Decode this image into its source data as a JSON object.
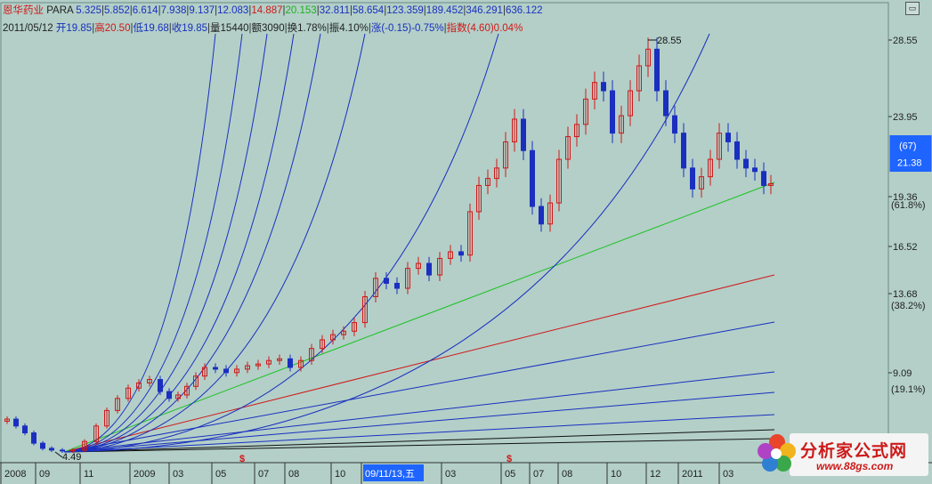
{
  "header": {
    "stock_name": "恩华药业",
    "indicator": "PARA",
    "indicator_values": [
      "5.325",
      "5.852",
      "6.614",
      "7.938",
      "9.137",
      "12.083",
      "14.887",
      "20.153",
      "32.811",
      "58.654",
      "123.359",
      "189.452",
      "346.291",
      "636.122"
    ],
    "indicator_colors": [
      "#1a2fbf",
      "#1a2fbf",
      "#1a2fbf",
      "#1a2fbf",
      "#1a2fbf",
      "#1a2fbf",
      "#d01818",
      "#1fb01f",
      "#1a2fbf",
      "#1a2fbf",
      "#1a2fbf",
      "#1a2fbf",
      "#1a2fbf",
      "#1a2fbf"
    ],
    "date": "2011/05/12",
    "ohlc_items": [
      {
        "label": "开",
        "value": "19.85",
        "color": "#1a2fbf"
      },
      {
        "label": "高",
        "value": "20.50",
        "color": "#d01818"
      },
      {
        "label": "低",
        "value": "19.68",
        "color": "#1a2fbf"
      },
      {
        "label": "收",
        "value": "19.85",
        "color": "#1a2fbf"
      },
      {
        "label": "量",
        "value": "15440",
        "color": "#222222"
      },
      {
        "label": "额",
        "value": "3090",
        "color": "#222222"
      },
      {
        "label": "换",
        "value": "1.78%",
        "color": "#222222"
      },
      {
        "label": "振",
        "value": "4.10%",
        "color": "#222222"
      },
      {
        "label": "涨",
        "value": "(-0.15)-0.75%",
        "color": "#1a2fbf"
      },
      {
        "label": "指数",
        "value": "(4.60)0.04%",
        "color": "#d01818"
      }
    ]
  },
  "corner_button": "▭",
  "chart_data": {
    "type": "candlestick",
    "x_tick_labels": [
      "2008",
      "09",
      "11",
      "2009",
      "03",
      "05",
      "07",
      "08",
      "10",
      "09/11/13,五",
      "03",
      "05",
      "07",
      "08",
      "10",
      "12",
      "2011",
      "03"
    ],
    "y_ticks": [
      {
        "value": 28.55,
        "label": "28.55"
      },
      {
        "value": 23.95,
        "label": "23.95"
      },
      {
        "value": 19.36,
        "label": "19.36"
      },
      {
        "value": 16.52,
        "label": "16.52"
      },
      {
        "value": 13.68,
        "label": "13.68"
      },
      {
        "value": 9.09,
        "label": "9.09"
      }
    ],
    "y_pct_labels": [
      {
        "value": 18.9,
        "label": "(61.8%)"
      },
      {
        "value": 13.0,
        "label": "(38.2%)"
      },
      {
        "value": 8.15,
        "label": "(19.1%)"
      }
    ],
    "current_box": {
      "top": "(67)",
      "bottom": "21.38"
    },
    "high_label": "28.55",
    "low_label": "4.49",
    "marker_symbol": "$",
    "ylim": [
      4.0,
      30.0
    ],
    "line_colors": {
      "gann": "#1a2fbf",
      "green": "#19c21f",
      "red": "#d01818",
      "black": "#111111"
    }
  },
  "logo": {
    "title": "分析家公式网",
    "url": "www.88gs.com"
  }
}
